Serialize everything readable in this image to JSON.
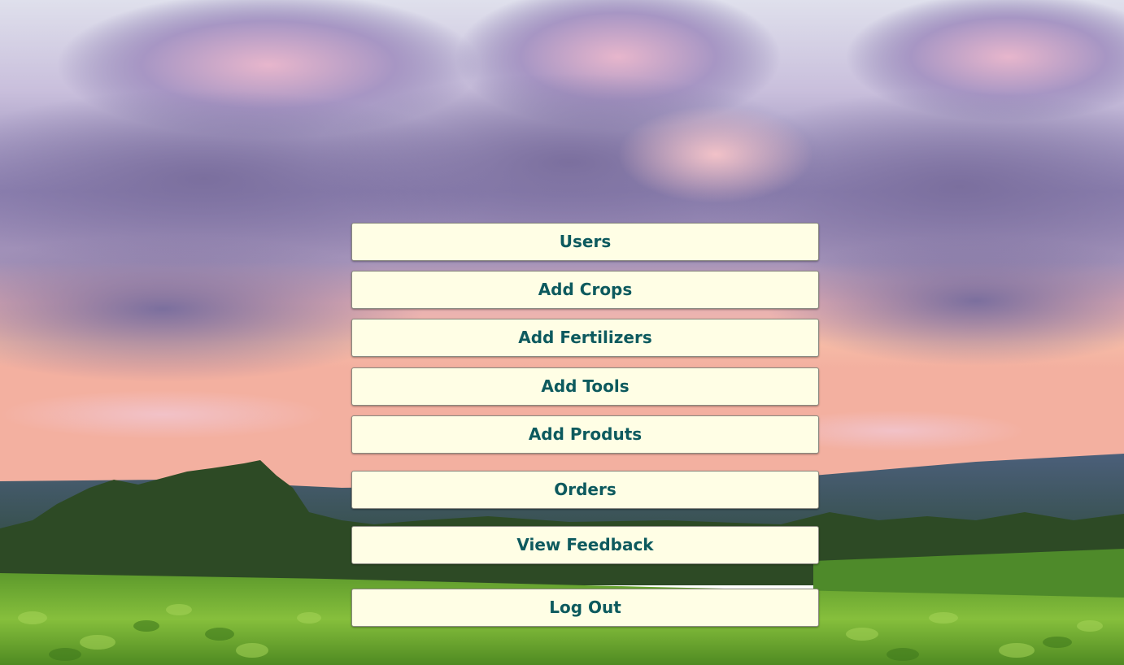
{
  "menu": {
    "users": "Users",
    "add_crops": "Add Crops",
    "add_fertilizers": "Add Fertilizers",
    "add_tools": "Add Tools",
    "add_produts": "Add Produts",
    "orders": "Orders",
    "view_feedback": "View Feedback",
    "log_out": "Log Out"
  },
  "colors": {
    "button_bg": "#fffee5",
    "button_text": "#0d5a5e",
    "sky_top": "#e6e2ee",
    "cloud_purple": "#8f7fb0",
    "horizon_pink": "#f4b49a",
    "field_green": "#7fb23a"
  },
  "background": {
    "scene": "sky with purple clouds over green crop field"
  }
}
